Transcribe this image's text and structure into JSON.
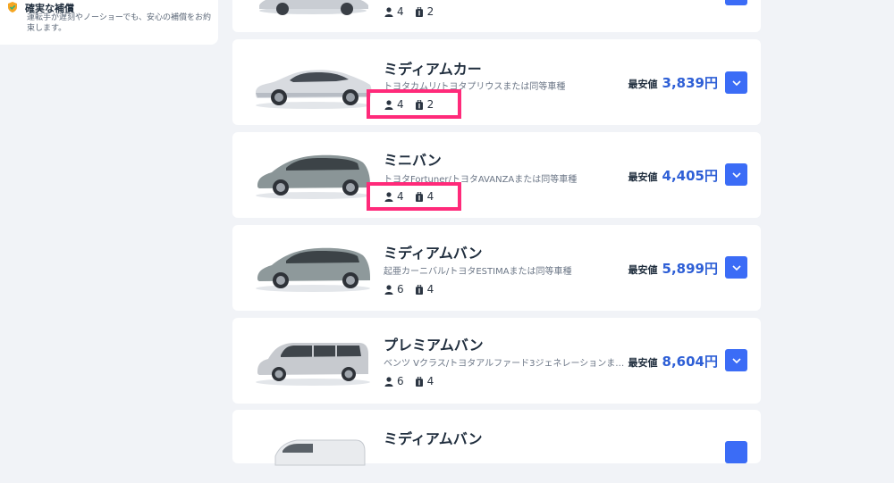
{
  "sidebar": {
    "feature_title": "確実な補償",
    "feature_desc": "運転手が遅刻やノーショーでも、安心の補償をお約束します。"
  },
  "price_label": "最安値",
  "accent_color": "#3b6cf6",
  "highlight_color": "#ff2a7a",
  "vehicles": [
    {
      "name": "",
      "models": "",
      "passengers": "4",
      "luggage": "2",
      "price": "",
      "image": "car-sedan"
    },
    {
      "name": "ミディアムカー",
      "models": "トヨタカムリ/トヨタプリウスまたは同等車種",
      "passengers": "4",
      "luggage": "2",
      "price": "3,839円",
      "image": "car-sedan"
    },
    {
      "name": "ミニバン",
      "models": "トヨタFortuner/トヨタAVANZAまたは同等車種",
      "passengers": "4",
      "luggage": "4",
      "price": "4,405円",
      "image": "car-minivan"
    },
    {
      "name": "ミディアムバン",
      "models": "起亜カーニバル/トヨタESTIMAまたは同等車種",
      "passengers": "6",
      "luggage": "4",
      "price": "5,899円",
      "image": "car-minivan"
    },
    {
      "name": "プレミアムバン",
      "models": "ベンツ Vクラス/トヨタアルファード3ジェネレーションまたは同等...",
      "passengers": "6",
      "luggage": "4",
      "price": "8,604円",
      "image": "car-premium-van"
    },
    {
      "name": "ミディアムバン",
      "models": "",
      "passengers": "",
      "luggage": "",
      "price": "",
      "image": "car-van"
    }
  ]
}
